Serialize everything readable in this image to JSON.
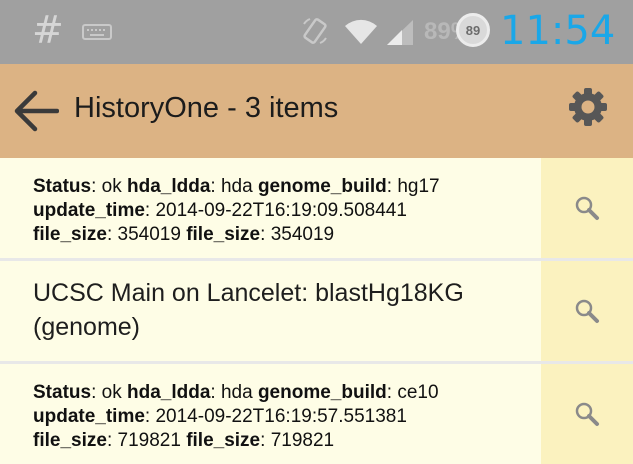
{
  "status_bar": {
    "left_icon": "#",
    "keyboard_icon": "keyboard-icon",
    "rotation_icon": "screen-rotation-icon",
    "wifi_icon": "wifi-icon",
    "signal_icon": "cell-signal-icon",
    "battery_percent_text": "89%",
    "battery_level": "89",
    "time": "11:54",
    "clock_color": "#1aa7e8"
  },
  "app_bar": {
    "title": "HistoryOne - 3 items",
    "back_icon": "back-arrow-icon",
    "settings_icon": "gear-icon",
    "background": "#dcb384"
  },
  "items": [
    {
      "status_label": "Status",
      "status_value": "ok",
      "hda_label": "hda_ldda",
      "hda_value": "hda",
      "genome_label": "genome_build",
      "genome_value": "hg17",
      "update_label": "update_time",
      "update_value": "2014-09-22T16:19:09.508441",
      "size_label": "file_size",
      "size_value": "354019",
      "size2_label": "file_size",
      "size2_value": "354019"
    },
    {
      "name_line1": "UCSC Main on Lancelet: blastHg18KG",
      "name_line2": "(genome)"
    },
    {
      "status_label": "Status",
      "status_value": "ok",
      "hda_label": "hda_ldda",
      "hda_value": "hda",
      "genome_label": "genome_build",
      "genome_value": "ce10",
      "update_label": "update_time",
      "update_value": "2014-09-22T16:19:57.551381",
      "size_label": "file_size",
      "size_value": "719821",
      "size2_label": "file_size",
      "size2_value": "719821"
    }
  ],
  "row_search_icon": "search-icon"
}
